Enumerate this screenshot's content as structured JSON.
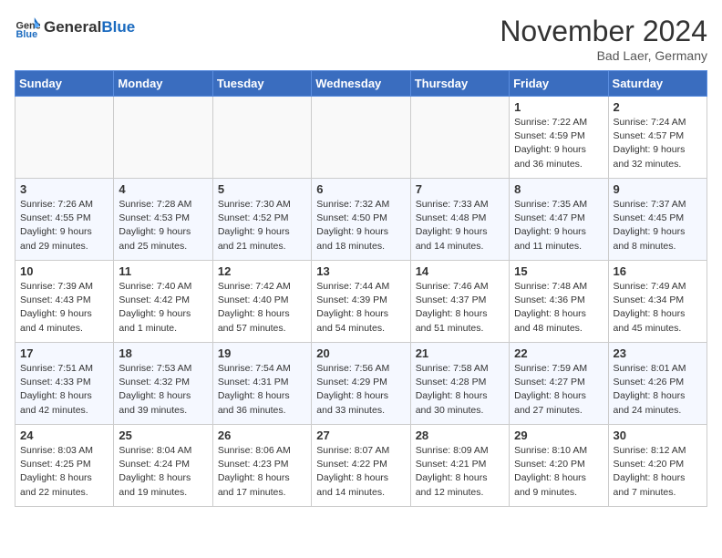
{
  "header": {
    "logo_general": "General",
    "logo_blue": "Blue",
    "month_title": "November 2024",
    "location": "Bad Laer, Germany"
  },
  "weekdays": [
    "Sunday",
    "Monday",
    "Tuesday",
    "Wednesday",
    "Thursday",
    "Friday",
    "Saturday"
  ],
  "weeks": [
    [
      {
        "day": "",
        "info": ""
      },
      {
        "day": "",
        "info": ""
      },
      {
        "day": "",
        "info": ""
      },
      {
        "day": "",
        "info": ""
      },
      {
        "day": "",
        "info": ""
      },
      {
        "day": "1",
        "info": "Sunrise: 7:22 AM\nSunset: 4:59 PM\nDaylight: 9 hours and 36 minutes."
      },
      {
        "day": "2",
        "info": "Sunrise: 7:24 AM\nSunset: 4:57 PM\nDaylight: 9 hours and 32 minutes."
      }
    ],
    [
      {
        "day": "3",
        "info": "Sunrise: 7:26 AM\nSunset: 4:55 PM\nDaylight: 9 hours and 29 minutes."
      },
      {
        "day": "4",
        "info": "Sunrise: 7:28 AM\nSunset: 4:53 PM\nDaylight: 9 hours and 25 minutes."
      },
      {
        "day": "5",
        "info": "Sunrise: 7:30 AM\nSunset: 4:52 PM\nDaylight: 9 hours and 21 minutes."
      },
      {
        "day": "6",
        "info": "Sunrise: 7:32 AM\nSunset: 4:50 PM\nDaylight: 9 hours and 18 minutes."
      },
      {
        "day": "7",
        "info": "Sunrise: 7:33 AM\nSunset: 4:48 PM\nDaylight: 9 hours and 14 minutes."
      },
      {
        "day": "8",
        "info": "Sunrise: 7:35 AM\nSunset: 4:47 PM\nDaylight: 9 hours and 11 minutes."
      },
      {
        "day": "9",
        "info": "Sunrise: 7:37 AM\nSunset: 4:45 PM\nDaylight: 9 hours and 8 minutes."
      }
    ],
    [
      {
        "day": "10",
        "info": "Sunrise: 7:39 AM\nSunset: 4:43 PM\nDaylight: 9 hours and 4 minutes."
      },
      {
        "day": "11",
        "info": "Sunrise: 7:40 AM\nSunset: 4:42 PM\nDaylight: 9 hours and 1 minute."
      },
      {
        "day": "12",
        "info": "Sunrise: 7:42 AM\nSunset: 4:40 PM\nDaylight: 8 hours and 57 minutes."
      },
      {
        "day": "13",
        "info": "Sunrise: 7:44 AM\nSunset: 4:39 PM\nDaylight: 8 hours and 54 minutes."
      },
      {
        "day": "14",
        "info": "Sunrise: 7:46 AM\nSunset: 4:37 PM\nDaylight: 8 hours and 51 minutes."
      },
      {
        "day": "15",
        "info": "Sunrise: 7:48 AM\nSunset: 4:36 PM\nDaylight: 8 hours and 48 minutes."
      },
      {
        "day": "16",
        "info": "Sunrise: 7:49 AM\nSunset: 4:34 PM\nDaylight: 8 hours and 45 minutes."
      }
    ],
    [
      {
        "day": "17",
        "info": "Sunrise: 7:51 AM\nSunset: 4:33 PM\nDaylight: 8 hours and 42 minutes."
      },
      {
        "day": "18",
        "info": "Sunrise: 7:53 AM\nSunset: 4:32 PM\nDaylight: 8 hours and 39 minutes."
      },
      {
        "day": "19",
        "info": "Sunrise: 7:54 AM\nSunset: 4:31 PM\nDaylight: 8 hours and 36 minutes."
      },
      {
        "day": "20",
        "info": "Sunrise: 7:56 AM\nSunset: 4:29 PM\nDaylight: 8 hours and 33 minutes."
      },
      {
        "day": "21",
        "info": "Sunrise: 7:58 AM\nSunset: 4:28 PM\nDaylight: 8 hours and 30 minutes."
      },
      {
        "day": "22",
        "info": "Sunrise: 7:59 AM\nSunset: 4:27 PM\nDaylight: 8 hours and 27 minutes."
      },
      {
        "day": "23",
        "info": "Sunrise: 8:01 AM\nSunset: 4:26 PM\nDaylight: 8 hours and 24 minutes."
      }
    ],
    [
      {
        "day": "24",
        "info": "Sunrise: 8:03 AM\nSunset: 4:25 PM\nDaylight: 8 hours and 22 minutes."
      },
      {
        "day": "25",
        "info": "Sunrise: 8:04 AM\nSunset: 4:24 PM\nDaylight: 8 hours and 19 minutes."
      },
      {
        "day": "26",
        "info": "Sunrise: 8:06 AM\nSunset: 4:23 PM\nDaylight: 8 hours and 17 minutes."
      },
      {
        "day": "27",
        "info": "Sunrise: 8:07 AM\nSunset: 4:22 PM\nDaylight: 8 hours and 14 minutes."
      },
      {
        "day": "28",
        "info": "Sunrise: 8:09 AM\nSunset: 4:21 PM\nDaylight: 8 hours and 12 minutes."
      },
      {
        "day": "29",
        "info": "Sunrise: 8:10 AM\nSunset: 4:20 PM\nDaylight: 8 hours and 9 minutes."
      },
      {
        "day": "30",
        "info": "Sunrise: 8:12 AM\nSunset: 4:20 PM\nDaylight: 8 hours and 7 minutes."
      }
    ]
  ]
}
